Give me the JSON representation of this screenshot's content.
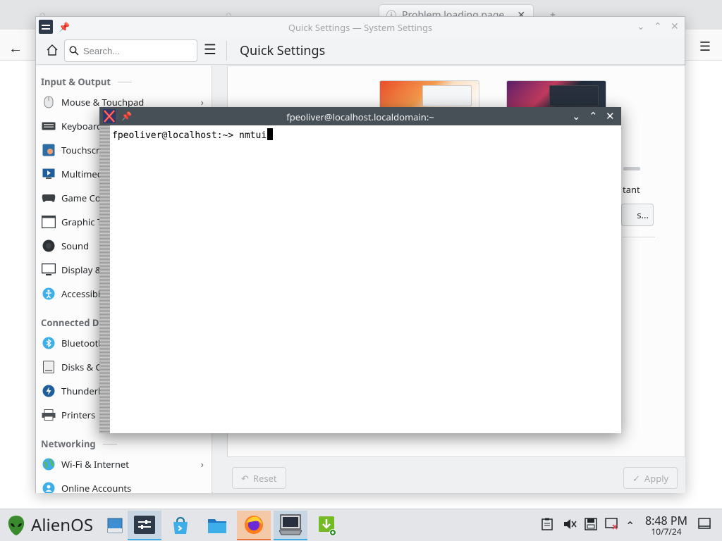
{
  "background_browser": {
    "tabs": [
      {
        "label": "",
        "active": false
      },
      {
        "label": "",
        "active": false
      },
      {
        "label": "Problem loading page",
        "active": true
      }
    ],
    "tab_close": "✕",
    "new_tab": "+"
  },
  "settings_window": {
    "title": "Quick Settings — System Settings",
    "search_placeholder": "Search...",
    "page_title": "Quick Settings",
    "sections": [
      {
        "header": "Input & Output",
        "items": [
          "Mouse & Touchpad",
          "Keyboard",
          "Touchscreen",
          "Multimedia",
          "Game Controller",
          "Graphic Tablet",
          "Sound",
          "Display & Monitor",
          "Accessibility"
        ]
      },
      {
        "header": "Connected Devices",
        "items": [
          "Bluetooth",
          "Disks & Cameras",
          "Thunderbolt",
          "Printers"
        ]
      },
      {
        "header": "Networking",
        "items": [
          "Wi-Fi & Internet",
          "Online Accounts"
        ]
      }
    ],
    "content_fragments": {
      "tant": "tant",
      "button": "s..."
    },
    "footer": {
      "reset": "Reset",
      "apply": "Apply"
    }
  },
  "terminal": {
    "title": "fpeoliver@localhost.localdomain:~",
    "prompt": "fpeoliver@localhost:~> ",
    "command": "nmtui"
  },
  "taskbar": {
    "start_label": "AlienOS",
    "clock_time": "8:48 PM",
    "clock_date": "10/7/24"
  },
  "colors": {
    "accent": "#3daee9",
    "terminal_titlebar": "#475057",
    "taskbar": "#e3e5e8"
  }
}
